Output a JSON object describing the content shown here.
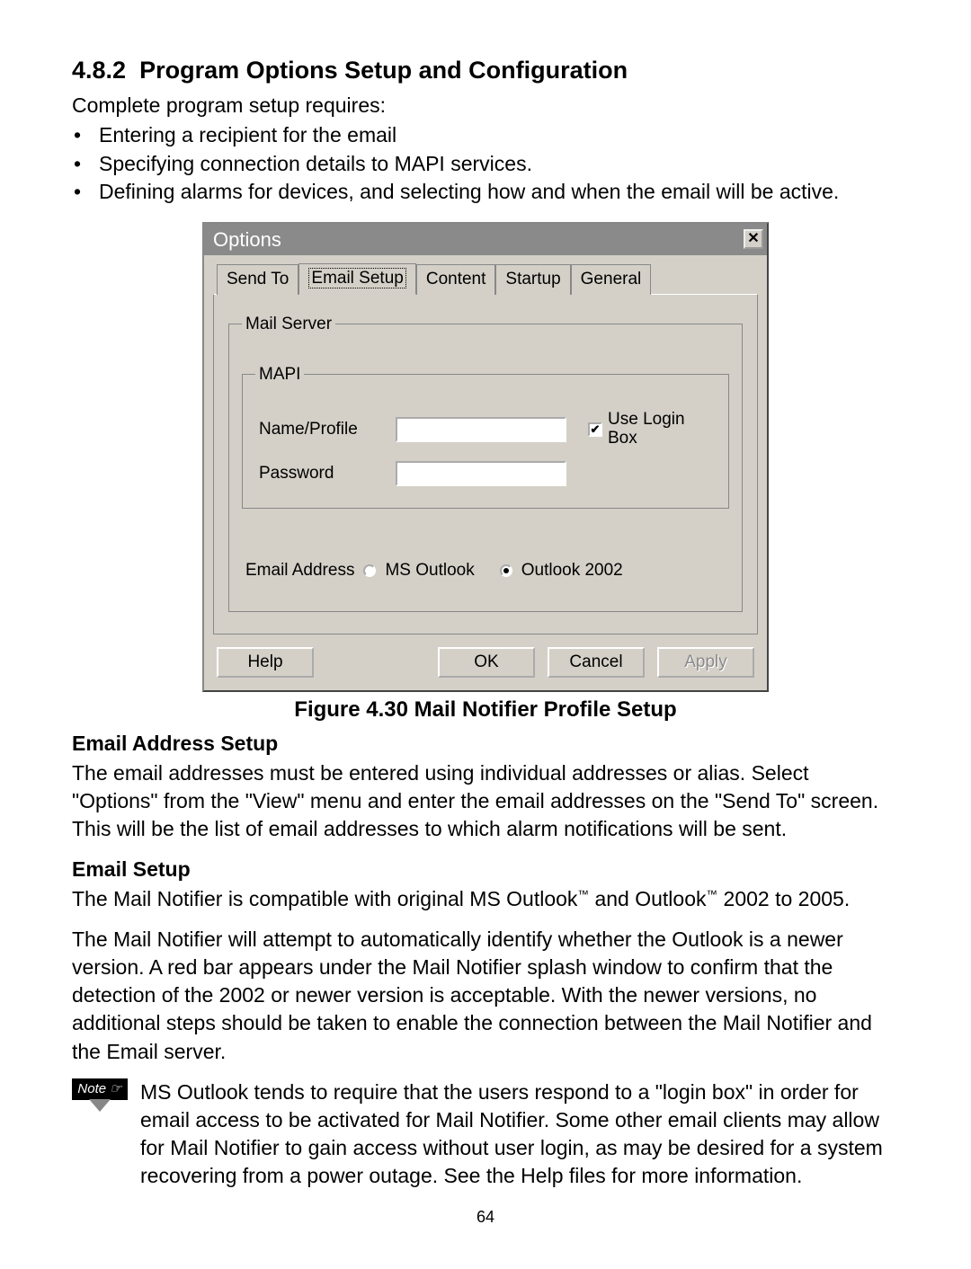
{
  "section": {
    "number": "4.8.2",
    "title": "Program Options Setup and Configuration",
    "intro": "Complete program setup requires:",
    "bullets": [
      "Entering a recipient for the email",
      "Specifying connection details to MAPI services.",
      "Defining alarms for devices, and selecting how and when the email will be active."
    ]
  },
  "dialog": {
    "title": "Options",
    "tabs": [
      "Send To",
      "Email Setup",
      "Content",
      "Startup",
      "General"
    ],
    "active_tab_index": 1,
    "group_mailserver": "Mail Server",
    "group_mapi": "MAPI",
    "label_nameprofile": "Name/Profile",
    "label_password": "Password",
    "checkbox_useloginbox": "Use Login Box",
    "checkbox_checked": true,
    "radio_label": "Email Address",
    "radio_options": [
      "MS Outlook",
      "Outlook 2002"
    ],
    "radio_selected_index": 1,
    "buttons": {
      "help": "Help",
      "ok": "OK",
      "cancel": "Cancel",
      "apply": "Apply"
    }
  },
  "figure_caption": "Figure 4.30  Mail Notifier Profile Setup",
  "email_address_setup": {
    "heading": "Email Address Setup",
    "body": "The email addresses must be entered using individual addresses or alias. Select \"Options\" from the \"View\" menu and enter the email addresses on the \"Send To\" screen. This will be the list of email addresses to which alarm notifications will be sent."
  },
  "email_setup": {
    "heading": "Email Setup",
    "body1_pre": "The Mail Notifier is compatible with original MS Outlook",
    "body1_mid": " and Outlook",
    "body1_post": " 2002 to 2005.",
    "body2": "The Mail Notifier will attempt to automatically identify whether the Outlook is a newer version.  A red bar appears under the Mail Notifier splash window to confirm that the detection of the 2002 or newer version is acceptable.  With the newer versions, no additional steps should be taken to enable the connection between the Mail Notifier and the Email server."
  },
  "note": {
    "label": "Note",
    "body": "MS Outlook tends to require that the users respond to a \"login box\" in order for email access to be activated for Mail Notifier.  Some other email clients may allow for Mail Notifier to gain access without user login, as may be desired for a system recovering from a power outage. See the Help files for more information."
  },
  "page_number": "64",
  "tm": "™"
}
